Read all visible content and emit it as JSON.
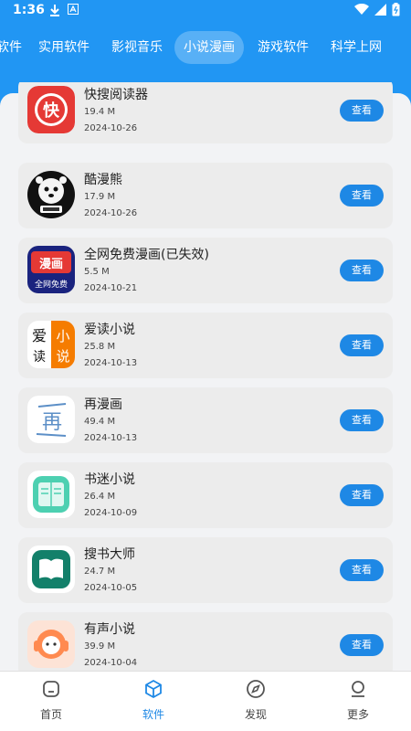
{
  "status_bar": {
    "time": "1:36"
  },
  "tabs": [
    {
      "label": "软件"
    },
    {
      "label": "实用软件"
    },
    {
      "label": "影视音乐"
    },
    {
      "label": "小说漫画",
      "active": true
    },
    {
      "label": "游戏软件"
    },
    {
      "label": "科学上网"
    }
  ],
  "apps": [
    {
      "name": "快搜阅读器",
      "size": "19.4 M",
      "date": "2024-10-26",
      "button": "查看",
      "icon": "kuaisou-icon"
    },
    {
      "name": "酷漫熊",
      "size": "17.9 M",
      "date": "2024-10-26",
      "button": "查看",
      "icon": "kumanxiong-icon"
    },
    {
      "name": "全网免费漫画(已失效)",
      "size": "5.5 M",
      "date": "2024-10-21",
      "button": "查看",
      "icon": "quanwang-manhua-icon"
    },
    {
      "name": "爱读小说",
      "size": "25.8 M",
      "date": "2024-10-13",
      "button": "查看",
      "icon": "aidu-xiaoshuo-icon"
    },
    {
      "name": "再漫画",
      "size": "49.4 M",
      "date": "2024-10-13",
      "button": "查看",
      "icon": "zai-manhua-icon"
    },
    {
      "name": "书迷小说",
      "size": "26.4 M",
      "date": "2024-10-09",
      "button": "查看",
      "icon": "shumi-xiaoshuo-icon"
    },
    {
      "name": "搜书大师",
      "size": "24.7 M",
      "date": "2024-10-05",
      "button": "查看",
      "icon": "soushu-dashi-icon"
    },
    {
      "name": "有声小说",
      "size": "39.9 M",
      "date": "2024-10-04",
      "button": "查看",
      "icon": "yousheng-xiaoshuo-icon"
    }
  ],
  "bottom_nav": [
    {
      "label": "首页",
      "icon": "home-icon"
    },
    {
      "label": "软件",
      "icon": "box-icon",
      "active": true
    },
    {
      "label": "发现",
      "icon": "compass-icon"
    },
    {
      "label": "更多",
      "icon": "user-icon"
    }
  ],
  "icon_text": {
    "kuai": "快",
    "manhua": "漫画",
    "quanwang": "全网免费",
    "ai": "爱",
    "du": "读",
    "xiao": "小",
    "shuo": "说",
    "zai": "再"
  },
  "colors": {
    "primary": "#2196F3",
    "button": "#1e88e5"
  }
}
